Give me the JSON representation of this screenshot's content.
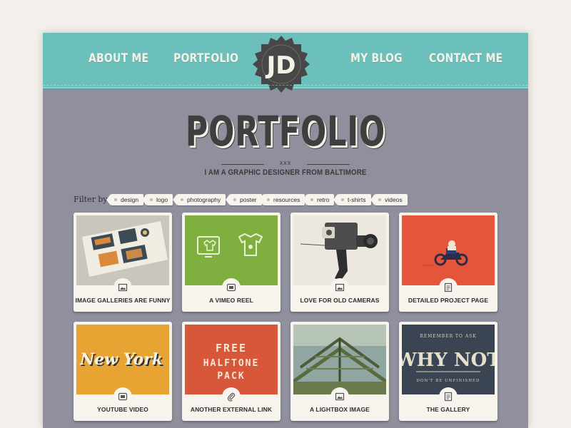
{
  "nav": {
    "about": "ABOUT ME",
    "portfolio": "PORTFOLIO",
    "blog": "MY BLOG",
    "contact": "CONTACT ME"
  },
  "logo": {
    "text": "JD"
  },
  "hero": {
    "title": "PORTFOLIO",
    "divider_mark": "xxx",
    "subtitle": "I AM A GRAPHIC DESIGNER FROM BALTIMORE"
  },
  "filter": {
    "label": "Filter by",
    "tags": [
      "design",
      "logo",
      "photography",
      "poster",
      "resources",
      "retro",
      "t-shirts",
      "videos"
    ]
  },
  "cards": [
    {
      "title": "IMAGE GALLERIES ARE FUNNY",
      "icon": "image-icon"
    },
    {
      "title": "A VIMEO REEL",
      "icon": "video-icon"
    },
    {
      "title": "LOVE FOR OLD CAMERAS",
      "icon": "image-icon"
    },
    {
      "title": "DETAILED PROJECT PAGE",
      "icon": "document-icon"
    },
    {
      "title": "YOUTUBE VIDEO",
      "icon": "video-icon"
    },
    {
      "title": "ANOTHER EXTERNAL LINK",
      "icon": "paperclip-icon"
    },
    {
      "title": "A LIGHTBOX IMAGE",
      "icon": "image-icon"
    },
    {
      "title": "THE GALLERY",
      "icon": "document-icon"
    }
  ],
  "thumb_text": {
    "newyork": "New York",
    "free": "FREE",
    "halftone": "HALFTONE",
    "pack": "PACK",
    "whynot_top": "REMEMBER TO ASK",
    "whynot": "WHY NOT",
    "whynot_bottom": "DON'T BE UNFINISHED"
  },
  "colors": {
    "page_bg": "#8f8f9e",
    "header_bg": "#6bc0bc",
    "card_bg": "#f7f4ee",
    "text_dark": "#3f3f3f"
  }
}
